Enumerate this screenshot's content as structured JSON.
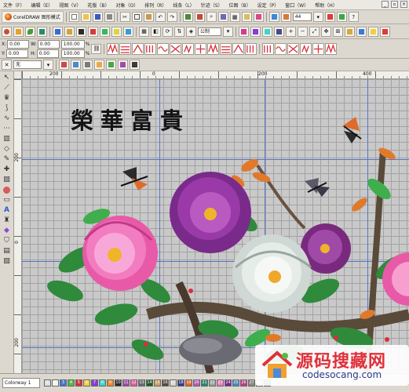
{
  "menu": {
    "items": [
      "文件（F）",
      "编辑（E）",
      "视图（V）",
      "花版（B）",
      "对象（O）",
      "排列（R）",
      "线条（L）",
      "针迹（S）",
      "位图（B）",
      "设定（P）",
      "窗口（W）",
      "帮助（H）"
    ]
  },
  "toolbar": {
    "app_title": "CorelDRAW 图形模式",
    "size_value": "44",
    "unit_value": "公制"
  },
  "props": {
    "x_label": "X:",
    "x_value": "0.00",
    "y_label": "Y:",
    "y_value": "0.00",
    "w_label": "W:",
    "w_value": "0.00",
    "h_label": "H:",
    "h_value": "0.00",
    "sx_value": "100.00",
    "sy_value": "100.00",
    "pct": "%",
    "fill_value": "无"
  },
  "ruler": {
    "h_numbers": [
      "200",
      "0",
      "200",
      "400"
    ],
    "v_numbers": [
      "200",
      "0",
      "200"
    ]
  },
  "canvas": {
    "title": "榮華富貴"
  },
  "status": {
    "colorway": "Colorway 1",
    "swatch_numbers": [
      "1",
      "2",
      "3",
      "4",
      "5",
      "6",
      "7",
      "8",
      "9",
      "10",
      "11",
      "12",
      "13",
      "14",
      "15",
      "16",
      "17",
      "18",
      "19",
      "20",
      "21",
      "22",
      "23",
      "24",
      "25",
      "26",
      "27",
      "28",
      "29"
    ]
  },
  "watermark": {
    "cn_text": "源码搜藏网",
    "url": "codesocang.com"
  },
  "colors": {
    "guide": "#5576c8",
    "menu_bg": "#ece9e2",
    "canvas_bg": "#c9c9c9"
  }
}
